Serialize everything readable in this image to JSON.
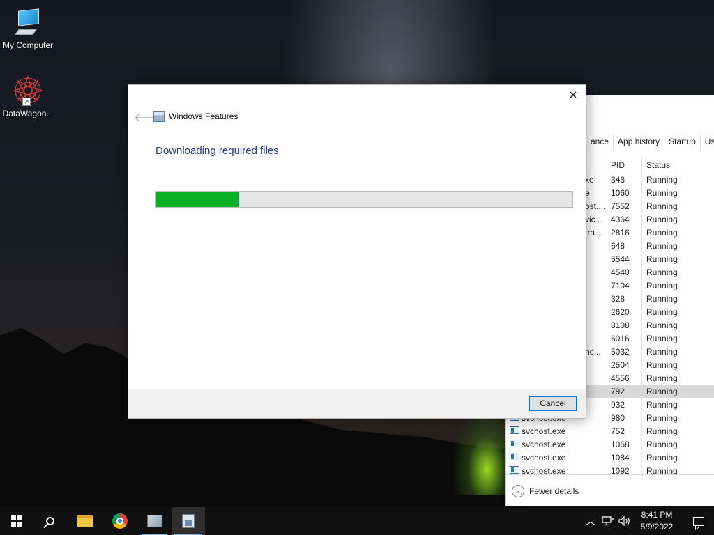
{
  "desktop": {
    "icons": [
      {
        "label": "My Computer",
        "icon": "computer-icon"
      },
      {
        "label": "DataWagon...",
        "icon": "datawagon-icon"
      }
    ]
  },
  "dialog": {
    "title": "Windows Features",
    "heading": "Downloading required files",
    "progress": 0.2,
    "progress_color": "#06b025",
    "heading_color": "#1f3f8c",
    "cancel_label": "Cancel",
    "close_glyph": "✕",
    "back_glyph": "🡐"
  },
  "task_manager": {
    "tabs": [
      "ance",
      "App history",
      "Startup",
      "Users"
    ],
    "columns": {
      "pid": "PID",
      "status": "Status"
    },
    "rows": [
      {
        "name": "xe",
        "pid": "348",
        "status": "Running"
      },
      {
        "name": "e",
        "pid": "1060",
        "status": "Running"
      },
      {
        "name": "ost....",
        "pid": "7552",
        "status": "Running"
      },
      {
        "name": "vic...",
        "pid": "4364",
        "status": "Running"
      },
      {
        "name": "tra...",
        "pid": "2816",
        "status": "Running"
      },
      {
        "name": "",
        "pid": "648",
        "status": "Running"
      },
      {
        "name": "",
        "pid": "5544",
        "status": "Running"
      },
      {
        "name": "",
        "pid": "4540",
        "status": "Running"
      },
      {
        "name": "",
        "pid": "7104",
        "status": "Running"
      },
      {
        "name": "",
        "pid": "328",
        "status": "Running"
      },
      {
        "name": "",
        "pid": "2620",
        "status": "Running"
      },
      {
        "name": "",
        "pid": "8108",
        "status": "Running"
      },
      {
        "name": "",
        "pid": "6016",
        "status": "Running"
      },
      {
        "name": "nc...",
        "pid": "5032",
        "status": "Running"
      },
      {
        "name": "",
        "pid": "2504",
        "status": "Running"
      },
      {
        "name": "",
        "pid": "4556",
        "status": "Running"
      },
      {
        "name": "",
        "pid": "792",
        "status": "Running",
        "selected": true
      },
      {
        "name": "",
        "pid": "932",
        "status": "Running"
      },
      {
        "name": "svchost.exe",
        "pid": "980",
        "status": "Running",
        "icon": true
      },
      {
        "name": "svchost.exe",
        "pid": "752",
        "status": "Running",
        "icon": true
      },
      {
        "name": "svchost.exe",
        "pid": "1068",
        "status": "Running",
        "icon": true
      },
      {
        "name": "svchost.exe",
        "pid": "1084",
        "status": "Running",
        "icon": true
      },
      {
        "name": "svchost.exe",
        "pid": "1092",
        "status": "Running",
        "icon": true
      }
    ],
    "fewer_details": "Fewer details"
  },
  "taskbar": {
    "items": [
      "start-icon",
      "search-icon",
      "file-explorer-icon",
      "chrome-icon",
      "computer-management-icon",
      "windows-features-icon"
    ],
    "clock_time": "8:41 PM",
    "clock_date": "5/9/2022",
    "accent": "#76b9ed"
  }
}
